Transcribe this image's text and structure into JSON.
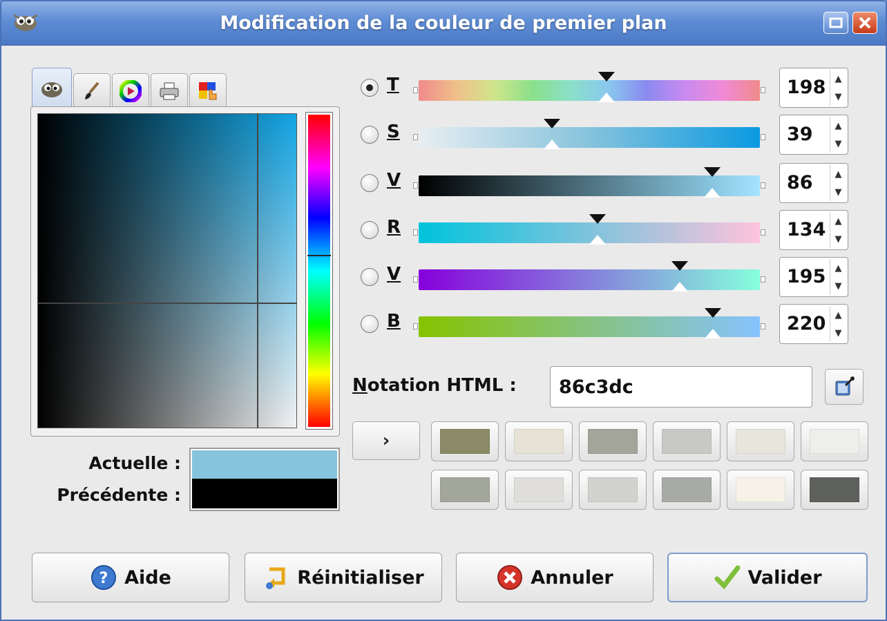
{
  "window": {
    "title": "Modification de la couleur de premier plan"
  },
  "tabs": [
    {
      "name": "gimp-selector-tab",
      "icon": "wilber-icon"
    },
    {
      "name": "brush-tab",
      "icon": "paintbrush-icon"
    },
    {
      "name": "color-wheel-tab",
      "icon": "color-wheel-icon"
    },
    {
      "name": "printer-tab",
      "icon": "printer-icon"
    },
    {
      "name": "watercolor-tab",
      "icon": "palette-hand-icon"
    }
  ],
  "swatches": {
    "current_label": "Actuelle :",
    "previous_label": "Précédente :",
    "current_color": "#86c3dc",
    "previous_color": "#000000"
  },
  "channels": [
    {
      "letter": "T",
      "value": "198",
      "selected": true,
      "level": 0.55
    },
    {
      "letter": "S",
      "value": "39",
      "selected": false,
      "level": 0.39
    },
    {
      "letter": "V",
      "value": "86",
      "selected": false,
      "level": 0.86
    },
    {
      "letter": "R",
      "value": "134",
      "selected": false,
      "level": 0.525
    },
    {
      "letter": "V",
      "value": "195",
      "selected": false,
      "level": 0.765
    },
    {
      "letter": "B",
      "value": "220",
      "selected": false,
      "level": 0.863
    }
  ],
  "html_notation": {
    "label": "Notation HTML :",
    "accel": "N",
    "value": "86c3dc"
  },
  "history": {
    "arrow": "›",
    "colors": [
      "#8a8a66",
      "#e6e2d6",
      "#a3a59a",
      "#c8c8c4",
      "#e8e6dc",
      "#eeeeea",
      "#a3a69a",
      "#e0dedb",
      "#d2d2ce",
      "#a8aaa6",
      "#f6f2e8",
      "#5e605c"
    ]
  },
  "buttons": {
    "help": "Aide",
    "reset": "Réinitialiser",
    "cancel": "Annuler",
    "ok": "Valider"
  },
  "colors": {
    "title_bg": "#5e8cd4",
    "accent": "#4a72b8"
  }
}
